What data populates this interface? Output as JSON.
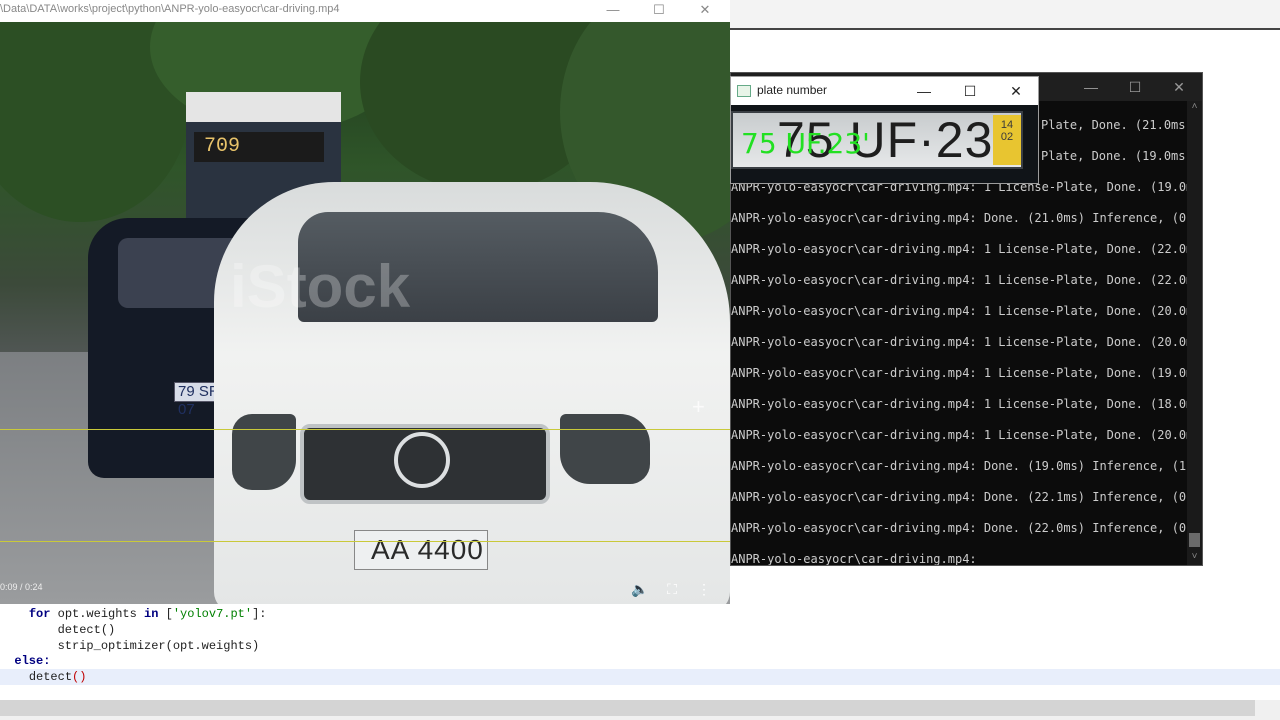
{
  "video": {
    "title": "\\Data\\DATA\\works\\project\\python\\ANPR-yolo-easyocr\\car-driving.mp4",
    "time": "0:09 / 0:24",
    "progress": 0.375,
    "watermark": "iStock",
    "bus_sign": "709",
    "dark_plate": "79 SR 07",
    "white_plate": "AA 4400"
  },
  "plate_window": {
    "title": "plate number",
    "crop_text": "75 UF·23",
    "crop_band": "14\n02",
    "ocr_text": "75 UF.23'"
  },
  "console": {
    "lines": [
      "Plate, Done. (21.0ms)",
      "Plate, Done. (19.0ms)",
      "ANPR-yolo-easyocr\\car-driving.mp4: 1 License-Plate, Done. (19.0ms)",
      "ANPR-yolo-easyocr\\car-driving.mp4: Done. (21.0ms) Inference, (0.0m",
      "ANPR-yolo-easyocr\\car-driving.mp4: 1 License-Plate, Done. (22.0ms)",
      "ANPR-yolo-easyocr\\car-driving.mp4: 1 License-Plate, Done. (22.0ms)",
      "ANPR-yolo-easyocr\\car-driving.mp4: 1 License-Plate, Done. (20.0ms)",
      "ANPR-yolo-easyocr\\car-driving.mp4: 1 License-Plate, Done. (20.0ms)",
      "ANPR-yolo-easyocr\\car-driving.mp4: 1 License-Plate, Done. (19.0ms)",
      "ANPR-yolo-easyocr\\car-driving.mp4: 1 License-Plate, Done. (18.0ms)",
      "ANPR-yolo-easyocr\\car-driving.mp4: 1 License-Plate, Done. (20.0ms)",
      "ANPR-yolo-easyocr\\car-driving.mp4: Done. (19.0ms) Inference, (1.0m",
      "ANPR-yolo-easyocr\\car-driving.mp4: Done. (22.1ms) Inference, (0.0m",
      "ANPR-yolo-easyocr\\car-driving.mp4: Done. (22.0ms) Inference, (0.0m",
      "ANPR-yolo-easyocr\\car-driving.mp4:"
    ]
  },
  "code": {
    "for_kw": "for",
    "for_var": " opt.weights ",
    "in_kw": "in",
    "list_open": " [",
    "weights_str": "'yolov7.pt'",
    "list_close": "]:",
    "detect1": "detect()",
    "strip": "strip_optimizer(opt.weights)",
    "else_kw": "else:",
    "detect2_name": "detect",
    "detect2_parens": "()"
  },
  "icons": {
    "minimize": "—",
    "maximize": "☐",
    "close": "✕",
    "volume": "🔈",
    "fullscreen": "⛶",
    "more": "⋮",
    "scroll_up": "˄",
    "scroll_down": "˅",
    "crosshair": "+"
  }
}
